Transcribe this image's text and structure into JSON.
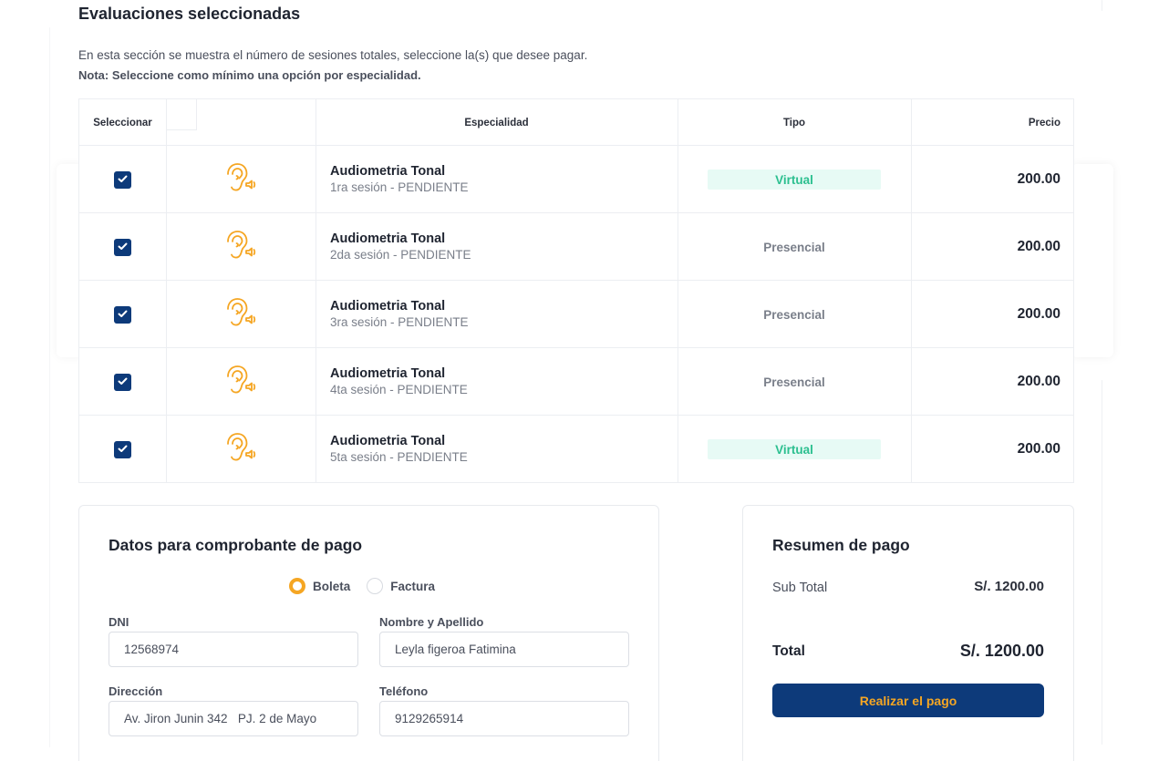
{
  "section": {
    "title": "Evaluaciones seleccionadas",
    "description": "En esta sección se muestra el número de sesiones totales, seleccione la(s) que desee pagar.",
    "note": "Nota: Seleccione como mínimo una opción por especialidad."
  },
  "table": {
    "headers": {
      "select": "Seleccionar",
      "specialty": "Especialidad",
      "type": "Tipo",
      "price": "Precio"
    },
    "rows": [
      {
        "checked": true,
        "icon": "ear-icon",
        "name": "Audiometria Tonal",
        "session": "1ra sesión - PENDIENTE",
        "type": "Virtual",
        "price": "200.00"
      },
      {
        "checked": true,
        "icon": "ear-icon",
        "name": "Audiometria Tonal",
        "session": "2da sesión - PENDIENTE",
        "type": "Presencial",
        "price": "200.00"
      },
      {
        "checked": true,
        "icon": "ear-icon",
        "name": "Audiometria Tonal",
        "session": "3ra sesión - PENDIENTE",
        "type": "Presencial",
        "price": "200.00"
      },
      {
        "checked": true,
        "icon": "ear-icon",
        "name": "Audiometria Tonal",
        "session": "4ta sesión - PENDIENTE",
        "type": "Presencial",
        "price": "200.00"
      },
      {
        "checked": true,
        "icon": "ear-icon",
        "name": "Audiometria Tonal",
        "session": "5ta sesión - PENDIENTE",
        "type": "Virtual",
        "price": "200.00"
      }
    ]
  },
  "billing": {
    "title": "Datos para comprobante de pago",
    "receipt_options": [
      {
        "label": "Boleta",
        "selected": true
      },
      {
        "label": "Factura",
        "selected": false
      }
    ],
    "dni_label": "DNI",
    "dni_value": "12568974",
    "name_label": "Nombre y Apellido",
    "name_value": "Leyla figeroa Fatimina",
    "address_label": "Dirección",
    "address_value": "Av. Jiron Junin 342   PJ. 2 de Mayo",
    "phone_label": "Teléfono",
    "phone_value": "9129265914"
  },
  "summary": {
    "title": "Resumen de pago",
    "subtotal_label": "Sub Total",
    "subtotal_value": "S/. 1200.00",
    "total_label": "Total",
    "total_value": "S/. 1200.00",
    "pay_button": "Realizar el pago"
  },
  "colors": {
    "primary": "#0d3a7a",
    "accent": "#f5a623",
    "virtual_bg": "#e7faf5",
    "virtual_text": "#2bbf8f"
  }
}
